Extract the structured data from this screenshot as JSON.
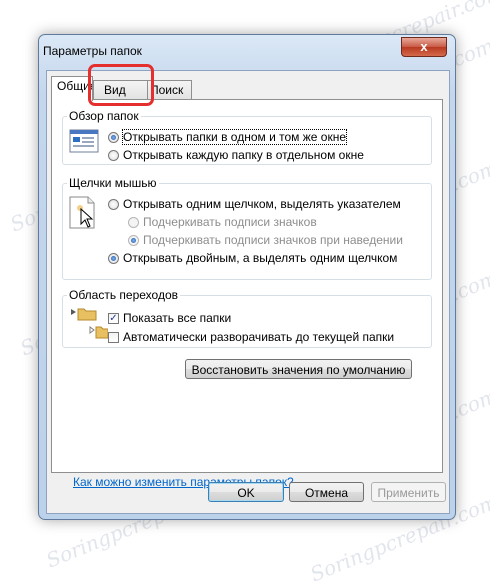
{
  "watermark_text": "Soringpcrepair.com",
  "dialog": {
    "title": "Параметры папок",
    "close_glyph": "x"
  },
  "tabs": [
    {
      "label": "Общие",
      "active": true
    },
    {
      "label": "Вид",
      "active": false
    },
    {
      "label": "Поиск",
      "active": false
    }
  ],
  "browse_folders": {
    "legend": "Обзор папок",
    "options": [
      {
        "label": "Открывать папки в одном и том же окне",
        "selected": true
      },
      {
        "label": "Открывать каждую папку в отдельном окне",
        "selected": false
      }
    ]
  },
  "mouse_clicks": {
    "legend": "Щелчки мышью",
    "single": {
      "label": "Открывать одним щелчком, выделять указателем",
      "selected": false
    },
    "sub_options": [
      {
        "label": "Подчеркивать подписи значков",
        "selected": false
      },
      {
        "label": "Подчеркивать подписи значков при наведении",
        "selected": true
      }
    ],
    "double": {
      "label": "Открывать двойным, а выделять одним щелчком",
      "selected": true
    }
  },
  "nav_pane": {
    "legend": "Область переходов",
    "items": [
      {
        "label": "Показать все папки",
        "checked": true
      },
      {
        "label": "Автоматически разворачивать до текущей папки",
        "checked": false
      }
    ]
  },
  "restore_defaults_label": "Восстановить значения по умолчанию",
  "help_link": "Как можно изменить параметры папок?",
  "buttons": {
    "ok": "OK",
    "cancel": "Отмена",
    "apply": "Применить"
  },
  "colors": {
    "highlight": "#e52f2f",
    "link": "#0066cc"
  }
}
